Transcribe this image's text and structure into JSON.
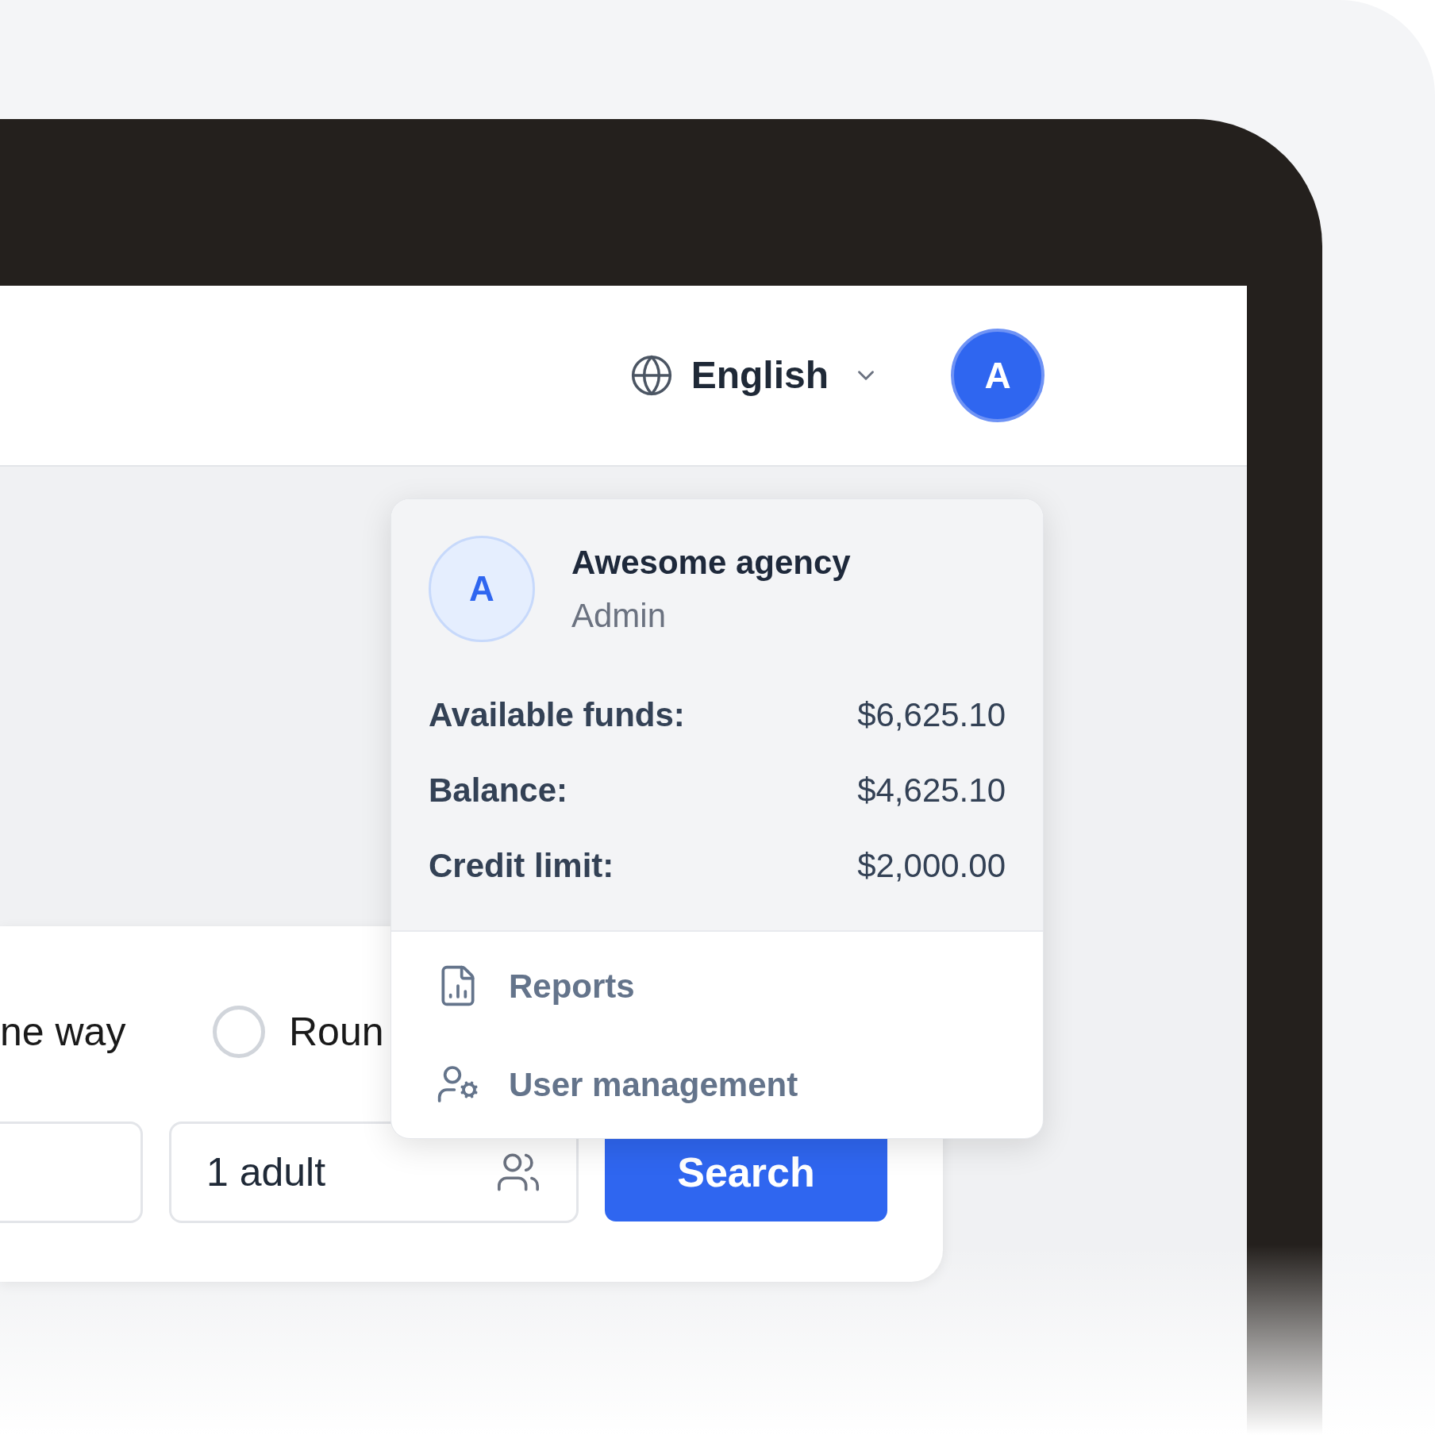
{
  "header": {
    "language": {
      "label": "English"
    },
    "avatar": {
      "initial": "A"
    }
  },
  "trip_type": {
    "one_way_label": "ne way",
    "round_trip": {
      "label": "Roun",
      "selected": false
    }
  },
  "search_form": {
    "passengers": {
      "value": "1 adult"
    },
    "search_button": "Search"
  },
  "account_menu": {
    "avatar_initial": "A",
    "name": "Awesome agency",
    "role": "Admin",
    "funds": [
      {
        "label": "Available funds:",
        "value": "$6,625.10"
      },
      {
        "label": "Balance:",
        "value": "$4,625.10"
      },
      {
        "label": "Credit limit:",
        "value": "$2,000.00"
      }
    ],
    "items": [
      {
        "kind": "reports",
        "label": "Reports"
      },
      {
        "kind": "users",
        "label": "User management"
      }
    ]
  }
}
